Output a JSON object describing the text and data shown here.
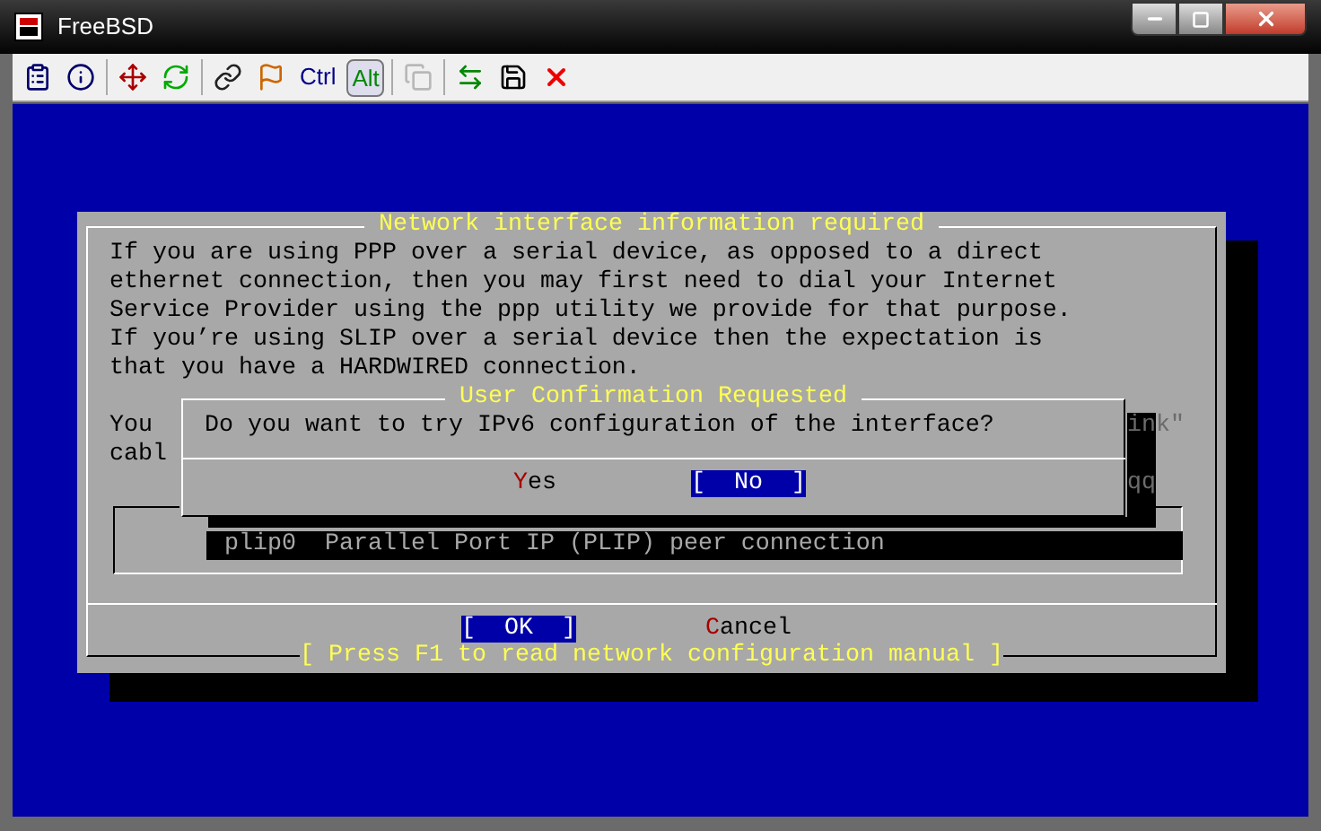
{
  "window": {
    "title": "FreeBSD"
  },
  "toolbar": {
    "modifier_keys": [
      {
        "label": "Ctrl",
        "on": false
      },
      {
        "label": "Alt",
        "on": true
      }
    ]
  },
  "dialog": {
    "title": "Network interface information required",
    "lines": [
      "If you are using PPP over a serial device, as opposed to a direct",
      "ethernet connection, then you may first need to dial your Internet",
      "Service Provider using the ppp utility we provide for that purpose.",
      "If you’re using SLIP over a serial device then the expectation is",
      "that you have a HARDWIRED connection."
    ],
    "partial_lines": [
      "You",
      "cabl"
    ],
    "right_fragments": [
      "ink\"",
      "qq"
    ],
    "list": [
      {
        "label": "plip0  Parallel Port IP (PLIP) peer connection",
        "selected": true
      }
    ],
    "buttons": [
      {
        "label": "[  OK  ]",
        "selected": true
      },
      {
        "label": "Cancel",
        "selected": false
      }
    ],
    "help": "[ Press F1 to read network configuration manual ]"
  },
  "confirm": {
    "title": "User Confirmation Requested",
    "message": "Do you want to try IPv6 configuration of the interface?",
    "buttons": [
      {
        "label": "Yes",
        "selected": false
      },
      {
        "label": "[  No  ]",
        "selected": true
      }
    ]
  }
}
